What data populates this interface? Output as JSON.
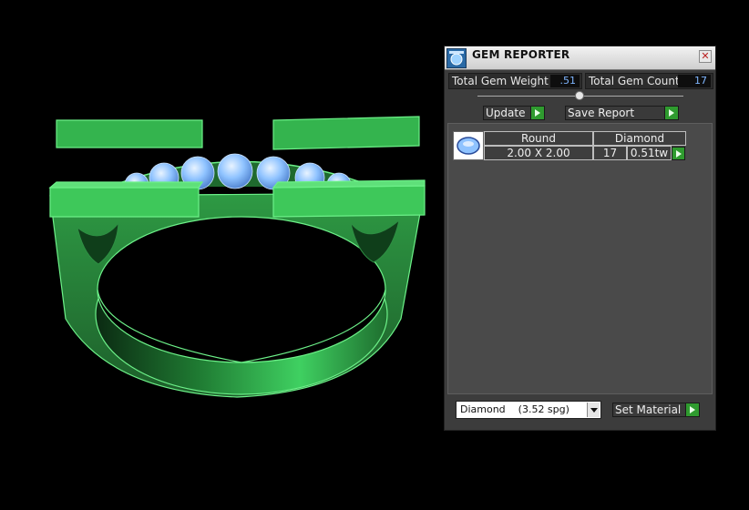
{
  "panel": {
    "title": "GEM REPORTER",
    "close_glyph": "✕",
    "total_gem_weight": {
      "label": "Total Gem Weight",
      "value": ".51"
    },
    "total_gem_count": {
      "label": "Total Gem Count",
      "value": "17"
    },
    "update_label": "Update",
    "save_report_label": "Save Report",
    "gem_row": {
      "shape": "Round",
      "size": "2.00 X 2.00",
      "material": "Diamond",
      "count": "17",
      "weight": "0.51tw"
    },
    "material_select": {
      "selected": "Diamond    (3.52 spg)"
    },
    "set_material_label": "Set Material"
  },
  "icons": {
    "app": "gem-reporter-app-icon",
    "close": "close-icon",
    "arrow": "play-arrow-icon",
    "dropdown": "chevron-down-icon",
    "gem": "round-gem-icon"
  },
  "colors": {
    "ring": "#3ec85a",
    "gems": "#8fc3ff",
    "arrow_button": "#2f9b2f",
    "value_text": "#7fb6ff"
  }
}
